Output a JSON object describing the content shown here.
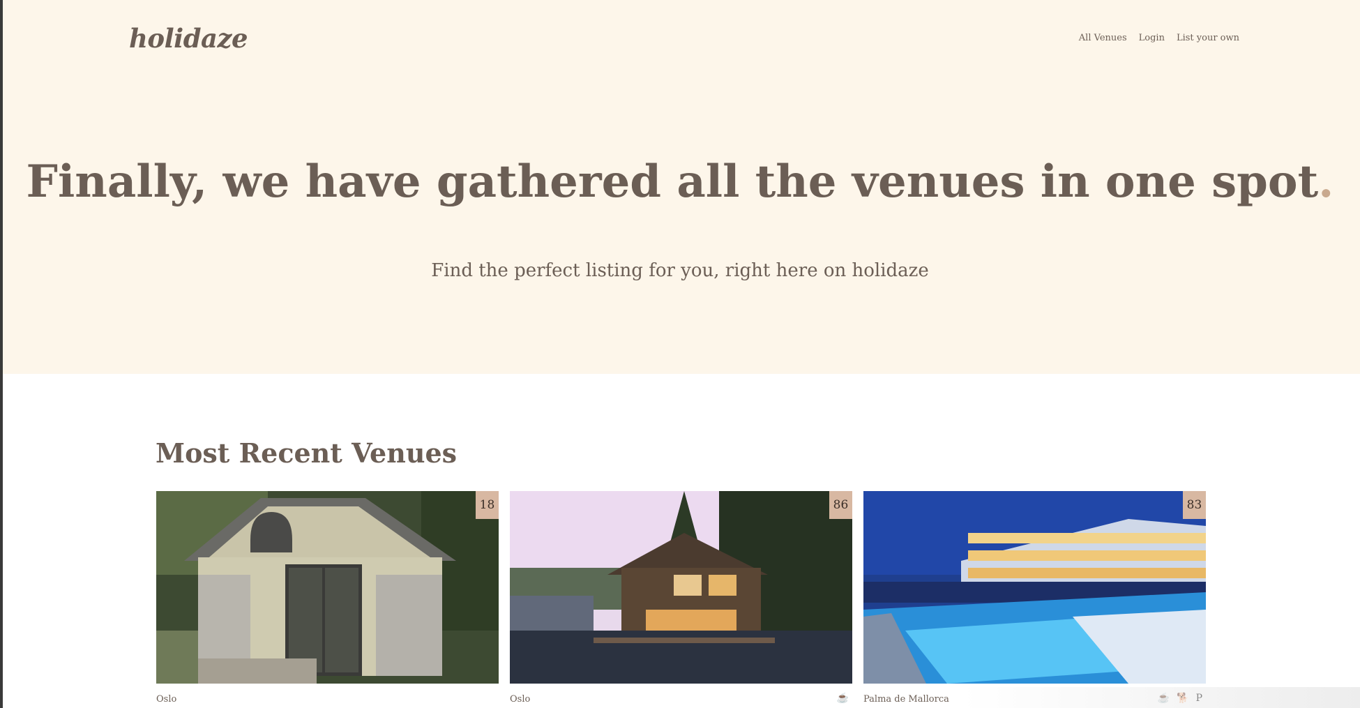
{
  "brand": {
    "logo": "holidaze"
  },
  "nav": {
    "all_venues": "All Venues",
    "login": "Login",
    "list_own": "List your own"
  },
  "hero": {
    "headline": "Finally, we have gathered all the venues in one spot",
    "headline_dot": ".",
    "subline": "Find the perfect listing for you, right here on holidaze"
  },
  "recent": {
    "title": "Most Recent Venues",
    "cards": [
      {
        "rating": "18",
        "location": "Oslo",
        "amenities": []
      },
      {
        "rating": "86",
        "location": "Oslo",
        "amenities": [
          "breakfast-icon"
        ]
      },
      {
        "rating": "83",
        "location": "Palma de Mallorca",
        "amenities": [
          "breakfast-icon",
          "pets-icon",
          "parking-icon"
        ]
      }
    ]
  },
  "amenity_glyphs": {
    "breakfast": "☕",
    "pets": "🐕",
    "parking": "P"
  },
  "colors": {
    "hero_bg": "#fdf6ea",
    "text": "#6b5e55",
    "accent": "#d8b8a2",
    "dot": "#c9a98e"
  }
}
